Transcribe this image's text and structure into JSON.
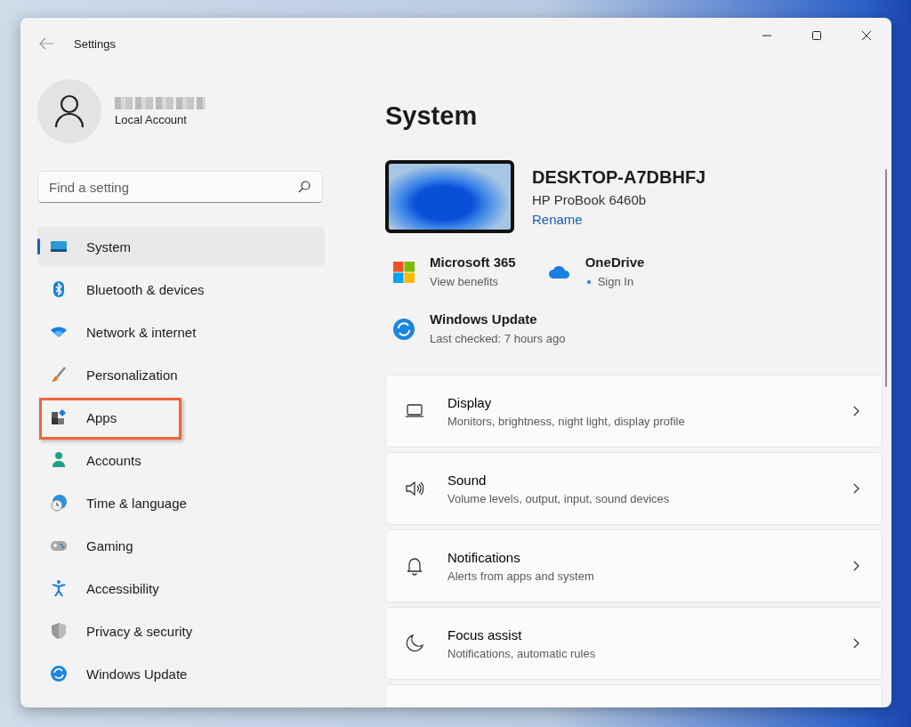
{
  "window": {
    "title": "Settings"
  },
  "account": {
    "type": "Local Account"
  },
  "search": {
    "placeholder": "Find a setting"
  },
  "nav": [
    {
      "label": "System",
      "selected": true,
      "highlighted": false
    },
    {
      "label": "Bluetooth & devices",
      "selected": false,
      "highlighted": false
    },
    {
      "label": "Network & internet",
      "selected": false,
      "highlighted": false
    },
    {
      "label": "Personalization",
      "selected": false,
      "highlighted": false
    },
    {
      "label": "Apps",
      "selected": false,
      "highlighted": true
    },
    {
      "label": "Accounts",
      "selected": false,
      "highlighted": false
    },
    {
      "label": "Time & language",
      "selected": false,
      "highlighted": false
    },
    {
      "label": "Gaming",
      "selected": false,
      "highlighted": false
    },
    {
      "label": "Accessibility",
      "selected": false,
      "highlighted": false
    },
    {
      "label": "Privacy & security",
      "selected": false,
      "highlighted": false
    },
    {
      "label": "Windows Update",
      "selected": false,
      "highlighted": false
    }
  ],
  "page": {
    "title": "System"
  },
  "device": {
    "name": "DESKTOP-A7DBHFJ",
    "model": "HP ProBook 6460b",
    "rename": "Rename"
  },
  "services": [
    {
      "title": "Microsoft 365",
      "subtitle": "View benefits",
      "status_dot": false
    },
    {
      "title": "OneDrive",
      "subtitle": "Sign In",
      "status_dot": true
    }
  ],
  "update": {
    "title": "Windows Update",
    "subtitle": "Last checked: 7 hours ago"
  },
  "cards": [
    {
      "title": "Display",
      "subtitle": "Monitors, brightness, night light, display profile"
    },
    {
      "title": "Sound",
      "subtitle": "Volume levels, output, input, sound devices"
    },
    {
      "title": "Notifications",
      "subtitle": "Alerts from apps and system"
    },
    {
      "title": "Focus assist",
      "subtitle": "Notifications, automatic rules"
    }
  ]
}
